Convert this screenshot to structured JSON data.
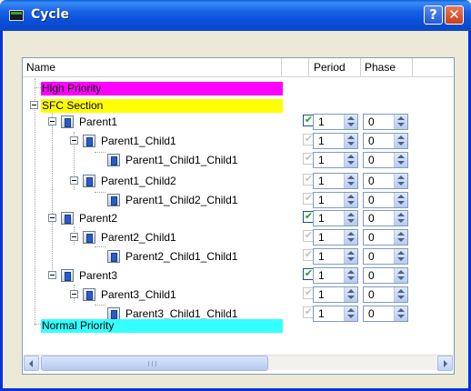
{
  "window": {
    "title": "Cycle"
  },
  "titlebar_buttons": {
    "help": "?",
    "close": "✕"
  },
  "columns": {
    "name": "Name",
    "period": "Period",
    "phase": "Phase"
  },
  "rows": [
    {
      "label": "High Priority",
      "type": "group",
      "color": "#ff00ff"
    },
    {
      "label": "SFC Section",
      "type": "group",
      "color": "#ffff00"
    },
    {
      "label": "Parent1",
      "checked": true,
      "enabled": true,
      "period": "1",
      "phase": "0"
    },
    {
      "label": "Parent1_Child1",
      "checked": true,
      "enabled": false,
      "period": "1",
      "phase": "0"
    },
    {
      "label": "Parent1_Child1_Child1",
      "checked": true,
      "enabled": false,
      "period": "1",
      "phase": "0"
    },
    {
      "label": "Parent1_Child2",
      "checked": true,
      "enabled": false,
      "period": "1",
      "phase": "0"
    },
    {
      "label": "Parent1_Child2_Child1",
      "checked": true,
      "enabled": false,
      "period": "1",
      "phase": "0"
    },
    {
      "label": "Parent2",
      "checked": true,
      "enabled": true,
      "period": "1",
      "phase": "0"
    },
    {
      "label": "Parent2_Child1",
      "checked": true,
      "enabled": false,
      "period": "1",
      "phase": "0"
    },
    {
      "label": "Parent2_Child1_Child1",
      "checked": true,
      "enabled": false,
      "period": "1",
      "phase": "0"
    },
    {
      "label": "Parent3",
      "checked": true,
      "enabled": true,
      "period": "1",
      "phase": "0"
    },
    {
      "label": "Parent3_Child1",
      "checked": true,
      "enabled": false,
      "period": "1",
      "phase": "0"
    },
    {
      "label": "Parent3_Child1_Child1",
      "checked": true,
      "enabled": false,
      "period": "1",
      "phase": "0"
    },
    {
      "label": "Normal Priority",
      "type": "group",
      "color": "#33ffff"
    }
  ],
  "icons": {
    "tree_node": "program-block-icon",
    "expander": "collapse-minus-icon",
    "check": "✔"
  }
}
